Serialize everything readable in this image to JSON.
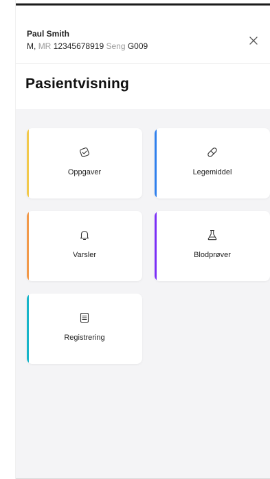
{
  "patient": {
    "name": "Paul Smith",
    "gender": "M,",
    "mr_label": "MR",
    "mr_number": "12345678919",
    "bed_label": "Seng",
    "bed_number": "G009"
  },
  "header": {
    "close_icon": "close-icon"
  },
  "page": {
    "title": "Pasientvisning"
  },
  "tiles": [
    {
      "label": "Oppgaver",
      "icon": "task-icon",
      "accent": "#f2c94c"
    },
    {
      "label": "Legemiddel",
      "icon": "pill-icon",
      "accent": "#2f80ed"
    },
    {
      "label": "Varsler",
      "icon": "bell-icon",
      "accent": "#f2994a"
    },
    {
      "label": "Blodprøver",
      "icon": "flask-icon",
      "accent": "#7b2ff7"
    },
    {
      "label": "Registrering",
      "icon": "document-icon",
      "accent": "#17b5c9"
    }
  ]
}
